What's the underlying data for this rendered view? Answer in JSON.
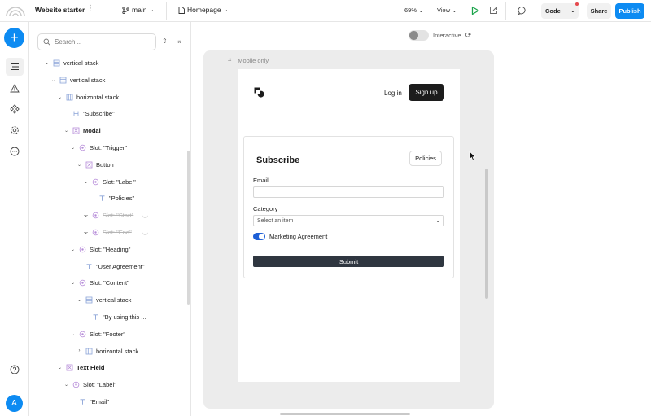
{
  "topbar": {
    "project_name": "Website starter",
    "branch": "main",
    "page": "Homepage",
    "zoom": "69%",
    "view_label": "View",
    "code_label": "Code",
    "share_label": "Share",
    "publish_label": "Publish"
  },
  "panel": {
    "search_placeholder": "Search...",
    "rows": [
      {
        "label": "vertical stack",
        "icon": "vstack-icon"
      },
      {
        "label": "vertical stack",
        "icon": "vstack-icon"
      },
      {
        "label": "horizontal stack",
        "icon": "hstack-icon"
      },
      {
        "label": "\"Subscribe\"",
        "icon": "heading-icon"
      },
      {
        "label": "Modal",
        "icon": "component-icon"
      },
      {
        "label": "Slot: \"Trigger\"",
        "icon": "slot-icon"
      },
      {
        "label": "Button",
        "icon": "component-icon"
      },
      {
        "label": "Slot: \"Label\"",
        "icon": "slot-icon"
      },
      {
        "label": "\"Policies\"",
        "icon": "text-icon"
      },
      {
        "label": "Slot: \"Start\"",
        "icon": "slot-icon"
      },
      {
        "label": "Slot: \"End\"",
        "icon": "slot-icon"
      },
      {
        "label": "Slot: \"Heading\"",
        "icon": "slot-icon"
      },
      {
        "label": "\"User Agreement\"",
        "icon": "text-icon"
      },
      {
        "label": "Slot: \"Content\"",
        "icon": "slot-icon"
      },
      {
        "label": "vertical stack",
        "icon": "vstack-icon"
      },
      {
        "label": "\"By using this ...",
        "icon": "text-icon"
      },
      {
        "label": "Slot: \"Footer\"",
        "icon": "slot-icon"
      },
      {
        "label": "horizontal stack",
        "icon": "hstack-icon"
      },
      {
        "label": "Text Field",
        "icon": "component-icon"
      },
      {
        "label": "Slot: \"Label\"",
        "icon": "slot-icon"
      },
      {
        "label": "\"Email\"",
        "icon": "text-icon"
      }
    ]
  },
  "canvas": {
    "interactive_label": "Interactive",
    "frame_label": "Mobile only",
    "nav": {
      "login": "Log in",
      "signup": "Sign up"
    },
    "card": {
      "title": "Subscribe",
      "policies_button": "Policies",
      "email_label": "Email",
      "category_label": "Category",
      "category_placeholder": "Select an item",
      "agreement_label": "Marketing Agreement",
      "submit_label": "Submit"
    }
  },
  "colors": {
    "accent": "#0d8bf2",
    "switch_on": "#1d5fd6",
    "dark_button": "#1c1c1c",
    "submit": "#2f3640"
  }
}
